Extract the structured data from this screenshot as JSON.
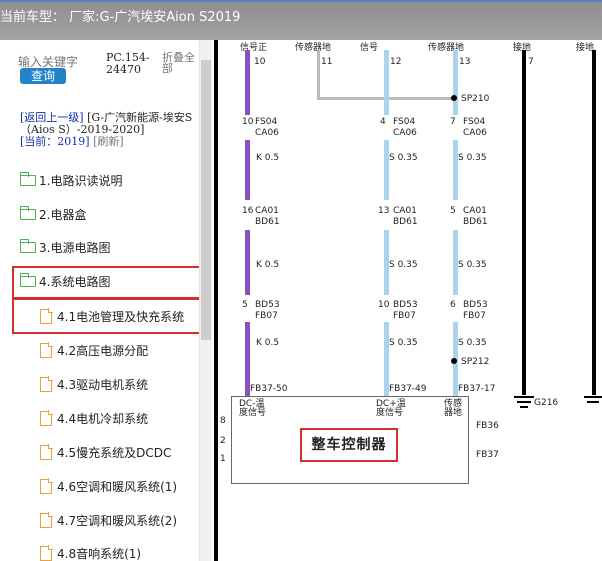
{
  "title_bar": "当前车型：  厂家:G-广汽埃安Aion S2019",
  "search": {
    "placeholder": "输入关键字",
    "button": "查询",
    "pc_code": "PC.154-24470",
    "fold": "折叠全部"
  },
  "nav": {
    "back_link": "[返回上一级]",
    "path": "[G-广汽新能源-埃安S（Aios S）-2019-2020]",
    "current_label": "[当前：",
    "current_value": "2019]",
    "refresh": "[刷新]"
  },
  "tree": [
    {
      "label": "1.电路识读说明",
      "icon": "folder-icon",
      "level": 0
    },
    {
      "label": "2.电器盒",
      "icon": "folder-icon",
      "level": 0
    },
    {
      "label": "3.电源电路图",
      "icon": "folder-icon",
      "level": 0
    },
    {
      "label": "4.系统电路图",
      "icon": "folder-open-icon",
      "level": 0
    },
    {
      "label": "4.1电池管理及快充系统",
      "icon": "document-icon",
      "level": 1
    },
    {
      "label": "4.2高压电源分配",
      "icon": "document-icon",
      "level": 1
    },
    {
      "label": "4.3驱动电机系统",
      "icon": "document-icon",
      "level": 1
    },
    {
      "label": "4.4电机冷却系统",
      "icon": "document-icon",
      "level": 1
    },
    {
      "label": "4.5慢充系统及DCDC",
      "icon": "document-icon",
      "level": 1
    },
    {
      "label": "4.6空调和暖风系统(1)",
      "icon": "document-icon",
      "level": 1
    },
    {
      "label": "4.7空调和暖风系统(2)",
      "icon": "document-icon",
      "level": 1
    },
    {
      "label": "4.8音响系统(1)",
      "icon": "document-icon",
      "level": 1
    }
  ],
  "diagram": {
    "headers": [
      "信号正",
      "传感器地",
      "信号",
      "传感器地",
      "接地",
      "接地"
    ],
    "pins_top": [
      "10",
      "11",
      "12",
      "13",
      "7"
    ],
    "splice_1": "SP210",
    "splice_2": "SP212",
    "conn_row1": {
      "pins": [
        "10",
        "4",
        "7"
      ],
      "codes_a": [
        "FS04",
        "FS04",
        "FS04"
      ],
      "codes_b": [
        "CA06",
        "CA06",
        "CA06"
      ]
    },
    "wire_row1": [
      "K 0.5",
      "S 0.35",
      "S 0.35"
    ],
    "conn_row2": {
      "pins": [
        "16",
        "13",
        "5"
      ],
      "codes_a": [
        "CA01",
        "CA01",
        "CA01"
      ],
      "codes_b": [
        "BD61",
        "BD61",
        "BD61"
      ]
    },
    "wire_row2": [
      "K 0.5",
      "S 0.35",
      "S 0.35"
    ],
    "conn_row3": {
      "pins": [
        "5",
        "10",
        "6"
      ],
      "codes_a": [
        "BD53",
        "BD53",
        "BD53"
      ],
      "codes_b": [
        "FB07",
        "FB07",
        "FB07"
      ]
    },
    "wire_row3": [
      "K 0.5",
      "S 0.35",
      "S 0.35"
    ],
    "ecu_pins": [
      "FB37-50",
      "FB37-49",
      "FB37-17"
    ],
    "ecu_signals": [
      "DC-温度信号",
      "DC+温度信号",
      "传感器地"
    ],
    "ecu_side_pins": [
      "8",
      "2",
      "1"
    ],
    "ecu_right": [
      "FB36",
      "FB37"
    ],
    "ground": "G216",
    "ecu_name": "整车控制器"
  },
  "colors": {
    "accent_red": "#d32f2f",
    "button_blue": "#2383c9",
    "wire_purple": "#8a4fc0",
    "wire_lightblue": "#aad4ec",
    "folder_green": "#4caf50",
    "doc_orange": "#e8a040"
  }
}
